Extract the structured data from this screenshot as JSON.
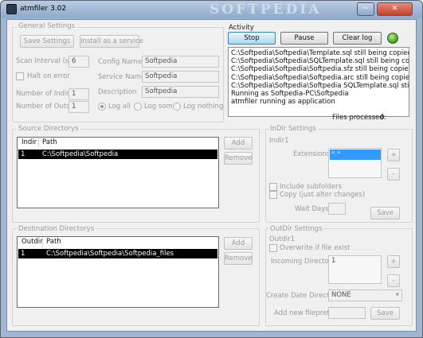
{
  "window": {
    "title": "atmfiler 3.02",
    "watermark": "SOFTPEDIA"
  },
  "general": {
    "title": "General Settings",
    "save_label": "Save Settings",
    "install_label": "Install as a service",
    "scan_interval_label": "Scan Interval (sec)",
    "scan_interval_value": "6",
    "halt_label": "Halt on error",
    "num_indirs_label": "Number of Indirs",
    "num_indirs_value": "1",
    "num_outdirs_label": "Number of Outdirs",
    "num_outdirs_value": "1",
    "config_name_label": "Config Name",
    "config_name_value": "Softpedia",
    "service_name_label": "Service Name",
    "service_name_value": "Softpedia",
    "description_label": "Description",
    "description_value": "Softpedia",
    "log_all": "Log all",
    "log_some": "Log some",
    "log_nothing": "Log nothing"
  },
  "activity": {
    "title": "Activity",
    "stop_label": "Stop",
    "pause_label": "Pause",
    "clear_label": "Clear log",
    "log_lines": [
      "C:\\Softpedia\\Softpedia\\Template.sql still being copied..",
      "C:\\Softpedia\\Softpedia\\SQLTemplate.sql still being copied..",
      "C:\\Softpedia\\Softpedia\\Softpedia.sfz still being copied..",
      "C:\\Softpedia\\Softpedia\\Softpedia.arc still being copied..",
      "C:\\Softpedia\\Softpedia\\Softpedia SQLTemplate.sql still being cop",
      "Running as Softpedia-PC\\Softpedia",
      "atmfiler running as application"
    ],
    "files_processed_label": "Files processed:",
    "files_processed_value": "0",
    "status_color": "#4caf22"
  },
  "source": {
    "title": "Source Directorys",
    "col_indir": "Indir",
    "col_path": "Path",
    "rows": [
      {
        "id": "1",
        "path": "C:\\Softpedia\\Softpedia"
      }
    ],
    "add_label": "Add",
    "remove_label": "Remove"
  },
  "indir_settings": {
    "title": "InDir Settings",
    "indir_label": "Indir1",
    "extensions_label": "Extensions",
    "extensions_value": "*.*",
    "include_sub_label": "Include subfolders",
    "copy_label": "Copy (just alter changes)",
    "wait_days_label": "Wait Days",
    "save_label": "Save",
    "plus": "+",
    "minus": "-"
  },
  "dest": {
    "title": "Destination Directorys",
    "col_outdir": "Outdir",
    "col_path": "Path",
    "rows": [
      {
        "id": "1",
        "path": "C:\\Softpedia\\Softpedia\\Softpedia_files"
      }
    ],
    "add_label": "Add",
    "remove_label": "Remove"
  },
  "outdir_settings": {
    "title": "OutDir Settings",
    "outdir_label": "Outdir1",
    "overwrite_label": "Overwrite if file exist",
    "incoming_label": "Incoming Directorys",
    "incoming_value": "1",
    "create_date_label": "Create Date Directory",
    "create_date_value": "NONE",
    "add_prefix_label": "Add new fileprefix",
    "save_label": "Save",
    "plus": "+",
    "minus": "-"
  }
}
